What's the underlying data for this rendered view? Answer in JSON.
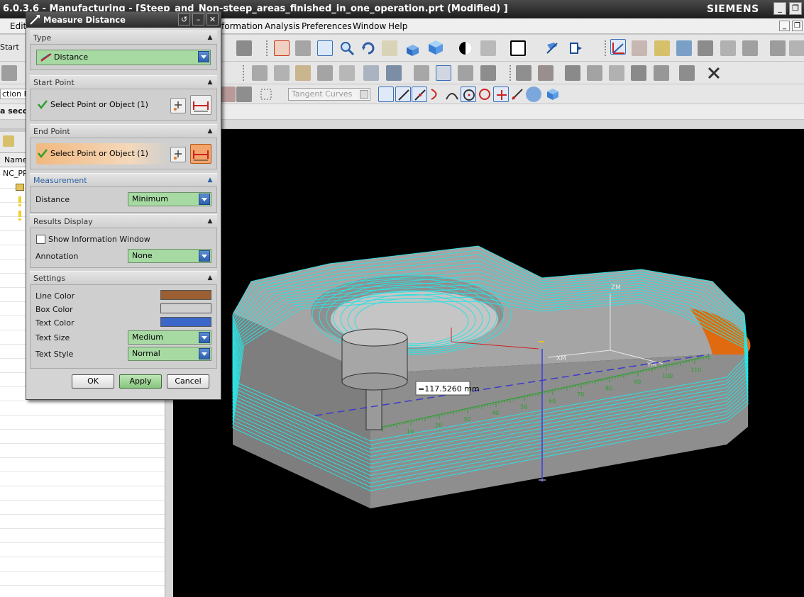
{
  "window": {
    "title": "6.0.3.6 - Manufacturing - [Steep_and_Non-steep_areas_finished_in_one_operation.prt (Modified) ]",
    "brand": "SIEMENS"
  },
  "menu": {
    "items": [
      "Edit",
      "formation",
      "Analysis",
      "Preferences",
      "Window",
      "Help"
    ]
  },
  "toolbar": {
    "start_label": "Start",
    "filter_label": "ction Fil",
    "prompt_label": "a secor",
    "snap_dropdown": "Tangent Curves"
  },
  "navigator": {
    "column_header": "Name",
    "row1": "NC_PR"
  },
  "dialog": {
    "title": "Measure Distance",
    "sections": {
      "type": {
        "header": "Type",
        "value": "Distance"
      },
      "start_point": {
        "header": "Start Point",
        "select_label": "Select Point or Object (1)"
      },
      "end_point": {
        "header": "End Point",
        "select_label": "Select Point or Object (1)"
      },
      "measurement": {
        "header": "Measurement",
        "distance_label": "Distance",
        "distance_value": "Minimum"
      },
      "results_display": {
        "header": "Results Display",
        "show_info_label": "Show Information Window",
        "show_info_checked": false,
        "annotation_label": "Annotation",
        "annotation_value": "None"
      },
      "settings": {
        "header": "Settings",
        "line_color_label": "Line Color",
        "box_color_label": "Box Color",
        "text_color_label": "Text Color",
        "text_size_label": "Text Size",
        "text_size_value": "Medium",
        "text_style_label": "Text Style",
        "text_style_value": "Normal",
        "line_color": "#9b5f33",
        "box_color": "#cfcfcf",
        "text_color": "#3a67c8"
      }
    },
    "buttons": {
      "ok": "OK",
      "apply": "Apply",
      "cancel": "Cancel"
    }
  },
  "viewport": {
    "measurement_readout": "=117.5260 mm",
    "axis_labels": {
      "z": "ZM",
      "x": "XM",
      "y": "YM"
    },
    "ruler_ticks": [
      "10",
      "20",
      "30",
      "40",
      "50",
      "60",
      "70",
      "80",
      "90",
      "100",
      "110"
    ]
  },
  "colors": {
    "toolpath": "#2ee0e0",
    "part": "#9a9a9a",
    "highlight_face": "#e06a10",
    "measure_line": "#3a3acc"
  }
}
